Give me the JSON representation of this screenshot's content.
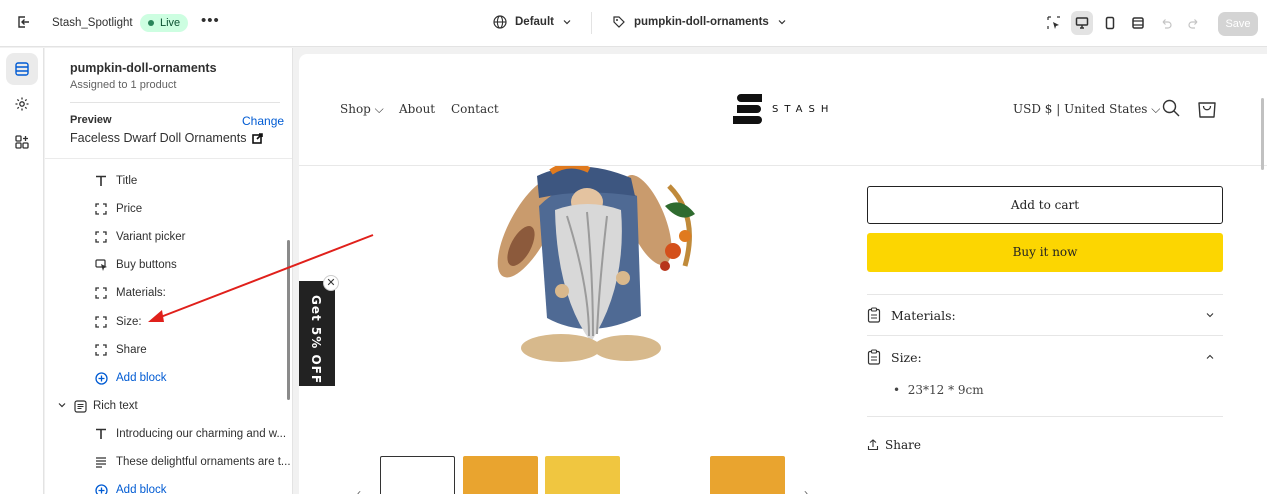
{
  "topbar": {
    "store_name": "Stash_Spotlight",
    "status": "Live",
    "more": "•••",
    "theme": "Default",
    "template": "pumpkin-doll-ornaments",
    "save": "Save"
  },
  "panel": {
    "title": "pumpkin-doll-ornaments",
    "subtitle": "Assigned to 1 product",
    "preview_label": "Preview",
    "change": "Change",
    "product": "Faceless Dwarf Doll Ornaments",
    "blocks": [
      {
        "label": "Title",
        "icon": "text-icon"
      },
      {
        "label": "Price",
        "icon": "block-icon"
      },
      {
        "label": "Variant picker",
        "icon": "block-icon"
      },
      {
        "label": "Buy buttons",
        "icon": "cursor-icon"
      },
      {
        "label": "Materials:",
        "icon": "block-icon"
      },
      {
        "label": "Size:",
        "icon": "block-icon"
      },
      {
        "label": "Share",
        "icon": "block-icon"
      }
    ],
    "add_block": "Add block",
    "section": "Rich text",
    "rich_blocks": [
      {
        "label": "Introducing our charming and w...",
        "icon": "text-icon"
      },
      {
        "label": "These delightful ornaments are t...",
        "icon": "paragraph-icon"
      }
    ],
    "add_block_2": "Add block"
  },
  "store": {
    "nav": [
      "Shop",
      "About",
      "Contact"
    ],
    "logo_text": "STASH",
    "currency": "USD $ | United States",
    "popup": "Get 5% OFF",
    "add_to_cart": "Add to cart",
    "buy_now": "Buy it now",
    "materials": "Materials:",
    "size": "Size:",
    "size_value": "23*12 * 9cm",
    "share": "Share"
  },
  "colors": {
    "accent_blue": "#005bd3",
    "live_green": "#29845a",
    "buy_yellow": "#fcd601",
    "annotation_red": "#e0201b"
  }
}
